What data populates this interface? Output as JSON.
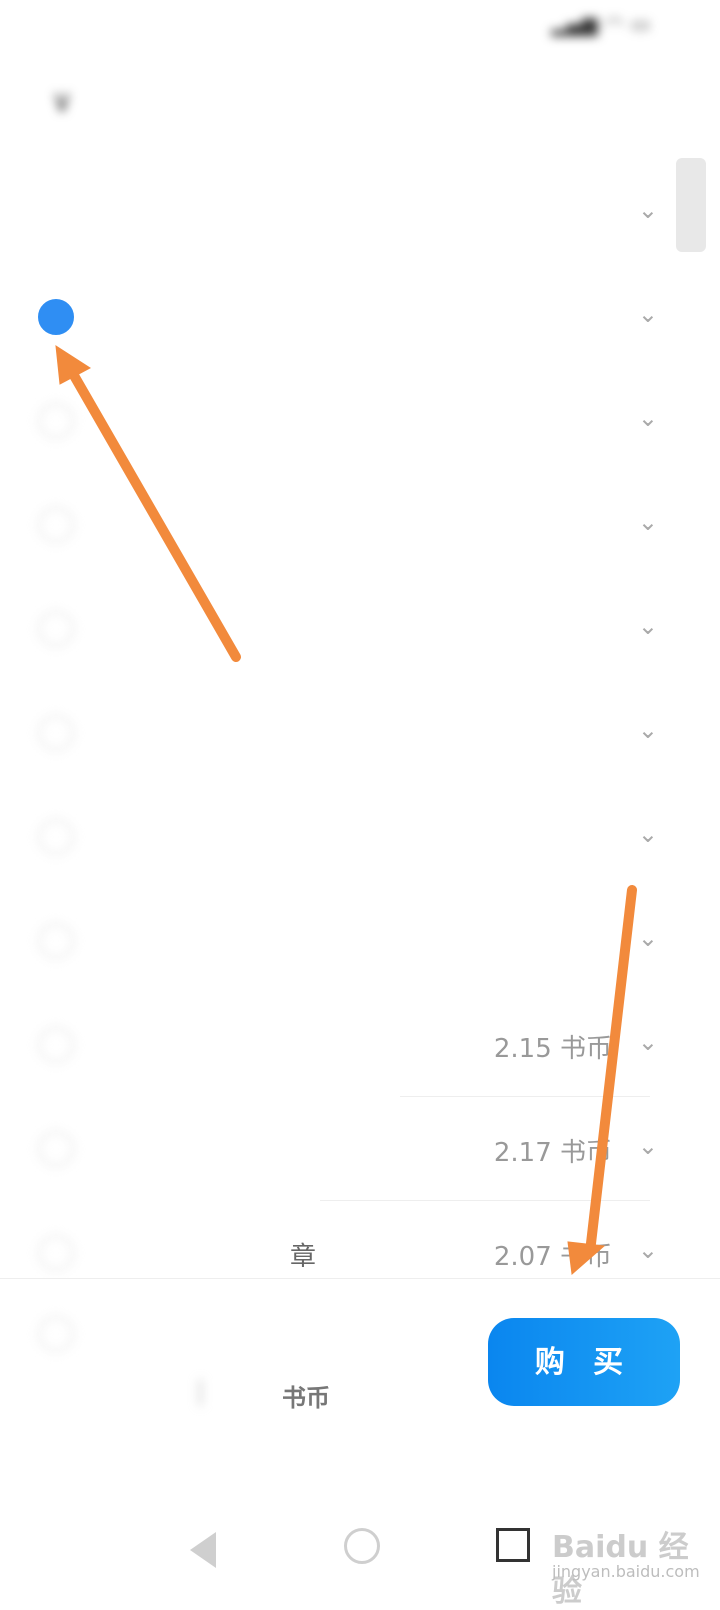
{
  "status_bar": {
    "left_text": "",
    "right_icons": [
      "signal-icon",
      "wifi-icon",
      "battery-icon"
    ]
  },
  "header": {
    "back_label": "∨",
    "title": "",
    "subtitle": ""
  },
  "chapters": [
    {
      "label": "",
      "price": "",
      "selected": false,
      "show_radio": false
    },
    {
      "label": "",
      "price": "",
      "selected": true,
      "show_radio": true
    },
    {
      "label": "",
      "price": "",
      "selected": false,
      "show_radio": true
    },
    {
      "label": "",
      "price": "",
      "selected": false,
      "show_radio": true
    },
    {
      "label": "",
      "price": "",
      "selected": false,
      "show_radio": true
    },
    {
      "label": "",
      "price": "",
      "selected": false,
      "show_radio": true
    },
    {
      "label": "",
      "price": "",
      "selected": false,
      "show_radio": true
    },
    {
      "label": "",
      "price": "",
      "selected": false,
      "show_radio": true
    },
    {
      "label": "",
      "price": "2.15 书币",
      "selected": false,
      "show_radio": true
    },
    {
      "label": "",
      "price": "2.17 书币",
      "selected": false,
      "show_radio": true
    },
    {
      "label": "章",
      "price": "2.07 书币",
      "selected": false,
      "show_radio": true
    }
  ],
  "summary": {
    "title": "",
    "count": "",
    "separator": "|",
    "cost": "",
    "cost_unit": "书币",
    "balance": ""
  },
  "buy_button": {
    "label": "购 买"
  },
  "nav_bar": {
    "back": "back-icon",
    "home": "home-icon",
    "recent": "recent-apps-icon"
  },
  "watermark": {
    "main": "Baidu 经验",
    "sub": "jingyan.baidu.com"
  },
  "colors": {
    "accent": "#2f8ef3",
    "button": "#0a86ef",
    "arrow": "#f28a3c"
  }
}
